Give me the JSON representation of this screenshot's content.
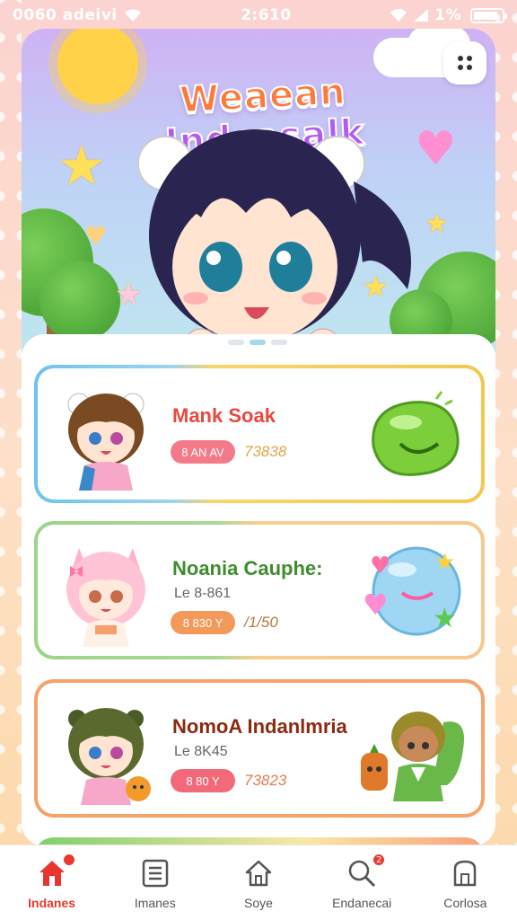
{
  "status_bar": {
    "left_text": "0060 adeivi",
    "time": "2:610",
    "right_text": "1%"
  },
  "hero": {
    "title_part1": "Weaean",
    "title_part2": "Indcasalk",
    "menu_icon": "grid-dots-icon"
  },
  "cards": [
    {
      "title": "Mank Soak",
      "subtitle": "",
      "badge": "8 AN AV",
      "value": "73838",
      "art_icon": "green-slime-icon"
    },
    {
      "title": "Noania Cauphe:",
      "subtitle": "Le 8-861",
      "badge": "8 830 Y",
      "value": "/1/50",
      "art_icon": "blue-blob-icon"
    },
    {
      "title": "NomoA Indanlmria",
      "subtitle": "Le 8K45",
      "badge": "8 80 Y",
      "value": "73823",
      "art_icon": "green-character-icon"
    }
  ],
  "nav": [
    {
      "label": "Indanes",
      "icon": "home-icon",
      "badge": "",
      "active": true
    },
    {
      "label": "Imanes",
      "icon": "list-icon",
      "badge": ""
    },
    {
      "label": "Soye",
      "icon": "house-outline-icon",
      "badge": ""
    },
    {
      "label": "Endanecai",
      "icon": "search-icon",
      "badge": "2"
    },
    {
      "label": "Corlosa",
      "icon": "store-icon",
      "badge": ""
    }
  ],
  "colors": {
    "accent": "#e8362e",
    "card1_border": "#6fc3ee",
    "card2_border": "#9bd48a",
    "card3_border": "#f4a46a"
  }
}
